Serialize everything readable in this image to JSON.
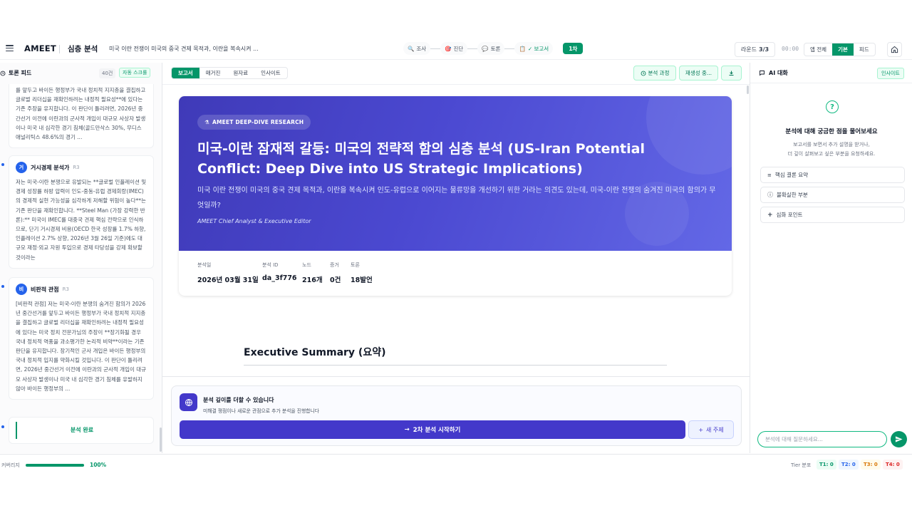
{
  "header": {
    "brand": "AMEET",
    "title": "심층 분석",
    "question": "미국 이란 전쟁이 미국의 중국 견제 목적과, 이란을 복속시켜 ...",
    "steps": [
      {
        "label": "조사",
        "icon": "🔍"
      },
      {
        "label": "진단",
        "icon": "🎯"
      },
      {
        "label": "토론",
        "icon": "💬"
      },
      {
        "label": "✓ 보고서",
        "icon": "📋"
      }
    ],
    "round_chip": "1차",
    "round_label": "라운드",
    "round_value": "3/3",
    "timer": "00:00",
    "views": [
      "앱 전체",
      "기본",
      "피드"
    ],
    "active_view": "기본"
  },
  "feed": {
    "title": "토론 피드",
    "count": "40건",
    "auto_scroll": "자동 스크롤",
    "cards": [
      {
        "text": "를 앞두고 바이든 행정부가 국내 정치적 지지층을 결집하고 글로벌 리더십을 재확인하려는 내정적 필요성**에 있다는 기존 주장을 유지합니다. 이 판단이 틀리려면, 2026년 중간선거 이전에 이란과의 군사적 개입이 대규모 사상자 발생이나 미국 내 심각한 경기 침체(골드만삭스 30%, 무디스 애널리틱스 48.6%의 경기 ..."
      },
      {
        "avatar": "거",
        "name": "거시경제 분석가",
        "round": "R3",
        "text": "저는 미국-이란 분쟁으로 유발되는 **글로벌 인플레이션 및 경제 성장률 하방 압력이 인도-중동-유럽 경제회랑(IMEC)의 경제적 실현 가능성을 심각하게 저해할 위험이 높다**는 기존 판단을 재확인합니다. **Steel Man (가장 강력한 반론):** 미국이 IMEC를 대중국 견제 핵심 전략으로 인식하므로, 단기 거시경제 비용(OECD 한국 성장률 1.7% 하향, 인플레이션 2.7% 상향, 2026년 3월 26일 기준)에도 대규모 재정·외교 자원 투입으로 경제 타당성을 강제 확보할 것이라는"
      },
      {
        "avatar": "비",
        "name": "비판적 관점",
        "round": "R3",
        "text": "[비판적 관점] 저는 미국-이란 분쟁의 숨겨진 함의가 2026년 중간선거를 앞두고 바이든 행정부가 국내 정치적 지지층을 결집하고 글로벌 리더십을 재확인하려는 내정적 필요성에 있다는 미국 정치 전문가님의 주장이 **장기화될 경우 국내 정치적 역풍을 과소평가한 논리적 비약**이라는 기존 판단을 유지합니다. 장기적인 군사 개입은 바이든 행정부의 국내 정치적 입지를 약화시킬 것입니다. 이 판단이 틀리려면, 2026년 중간선거 이전에 이란과의 군사적 개입이 대규모 사상자 발생이나 미국 내 심각한 경기 침체를 유발하지 않아 바이든 행정부의 ..."
      }
    ],
    "done": "분석 완료"
  },
  "center": {
    "tabs": [
      "보고서",
      "매거진",
      "원자료",
      "인사이트"
    ],
    "active_tab": "보고서",
    "actions": {
      "process": "분석 과정",
      "regen": "재생성 중..."
    },
    "hero": {
      "badge": "AMEET DEEP-DIVE RESEARCH",
      "title": "미국-이란 잠재적 갈등: 미국의 전략적 함의 심층 분석 (US-Iran Potential Conflict: Deep Dive into US Strategic Implications)",
      "subtitle": "미국 이란 전쟁이 미국의 중국 견제 목적과, 이란을 복속시켜 인도-유럽으로 이어지는 물류망을 개선하기 위한 거라는 의견도 있는데, 미국-이란 전쟁의 숨겨진 미국의 함의가 무엇일까?",
      "author": "AMEET Chief Analyst & Executive Editor"
    },
    "meta": [
      {
        "label": "분석일",
        "value": "2026년 03월 31일"
      },
      {
        "label": "분석 ID",
        "value": "da_3f776"
      },
      {
        "label": "노드",
        "value": "216개"
      },
      {
        "label": "증거",
        "value": "0건"
      },
      {
        "label": "토론",
        "value": "18발언"
      }
    ],
    "section_title": "Executive Summary (요약)",
    "deep": {
      "title": "분석 깊이를 더할 수 있습니다",
      "subtitle": "미해결 쟁점이나 새로운 관점으로 추가 분석을 진행합니다",
      "start": "2차 분석 시작하기",
      "new_topic": "새 주제"
    }
  },
  "ai": {
    "title": "AI 대화",
    "insight": "인사이트",
    "ask_title": "분석에 대해 궁금한 점을 물어보세요",
    "ask_sub_1": "보고서를 보면서 추가 설명을 받거나,",
    "ask_sub_2": "더 깊이 살펴보고 싶은 부분을 요청하세요.",
    "quick": [
      "핵심 결론 요약",
      "불확실한 부분",
      "심화 포인트"
    ],
    "placeholder": "분석에 대해 질문하세요..."
  },
  "footer": {
    "coverage_label": "커버리지",
    "coverage_value": "100%",
    "coverage_fraction": 1.0,
    "tier_label": "Tier 분포",
    "tiers": [
      "T1: 0",
      "T2: 0",
      "T3: 0",
      "T4: 0"
    ]
  },
  "colors": {
    "accent": "#059669",
    "indigo": "#4338ca"
  }
}
